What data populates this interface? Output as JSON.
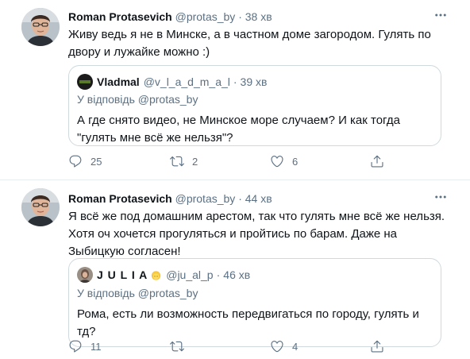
{
  "colors": {
    "text": "#0f1419",
    "muted": "#5b7083",
    "border": "#cfd9de",
    "divider": "#e6ecf0"
  },
  "tweets": [
    {
      "author": {
        "name": "Roman Protasevich",
        "handle": "@protas_by",
        "time": "38 хв"
      },
      "more_icon": "more-horizontal-icon",
      "text": "Живу ведь я не в Минске, а в частном доме загородом. Гулять по двору и лужайке можно :)",
      "quote": {
        "name": "Vladmal",
        "handle": "@v_l_a_d_m_a_l",
        "time": "39 хв",
        "reply_to": "У відповідь @protas_by",
        "text": "А где снято видео, не Минское море случаем? И как тогда \"гулять мне всё же нельзя\"?"
      },
      "actions": {
        "replies": "25",
        "retweets": "2",
        "likes": "6"
      }
    },
    {
      "author": {
        "name": "Roman Protasevich",
        "handle": "@protas_by",
        "time": "44 хв"
      },
      "more_icon": "more-horizontal-icon",
      "text": "Я всё же под домашним арестом, так что гулять мне всё же нельзя. Хотя оч хочется прогуляться и пройтись по барам. Даже на Зыбицкую согласен!",
      "quote": {
        "name": "J U L I A",
        "handle": "@ju_al_p",
        "time": "46 хв",
        "name_emoji": "blonde-person-emoji",
        "reply_to": "У відповідь @protas_by",
        "text": "Рома, есть ли возможность передвигаться по городу, гулять и тд?"
      },
      "actions": {
        "replies": "11",
        "retweets": "",
        "likes": "4"
      }
    }
  ],
  "separator": "·"
}
